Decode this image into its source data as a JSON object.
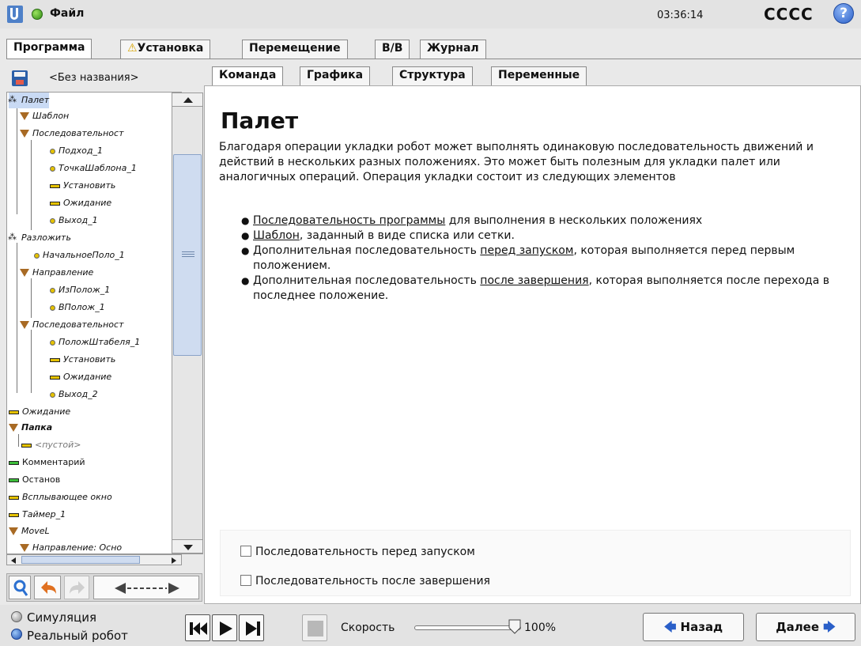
{
  "topbar": {
    "file_menu": "Файл",
    "clock": "03:36:14",
    "robot_name": "CCCC",
    "help_label": "?"
  },
  "main_tabs": [
    {
      "label": "Программа",
      "active": true
    },
    {
      "label": "Установка",
      "warning": true
    },
    {
      "label": "Перемещение"
    },
    {
      "label": "В/В"
    },
    {
      "label": "Журнал"
    }
  ],
  "left": {
    "program_name": "<Без названия>",
    "tree": [
      {
        "label": "Палет"
      },
      {
        "label": "Шаблон"
      },
      {
        "label": "Последовательност"
      },
      {
        "label": "Подход_1"
      },
      {
        "label": "ТочкаШаблона_1"
      },
      {
        "label": "Установить"
      },
      {
        "label": "Ожидание"
      },
      {
        "label": "Выход_1"
      },
      {
        "label": "Разложить"
      },
      {
        "label": "НачальноеПоло_1"
      },
      {
        "label": "Направление"
      },
      {
        "label": "ИзПолож_1"
      },
      {
        "label": "ВПолож_1"
      },
      {
        "label": "Последовательност"
      },
      {
        "label": "ПоложШтабеля_1"
      },
      {
        "label": "Установить"
      },
      {
        "label": "Ожидание"
      },
      {
        "label": "Выход_2"
      },
      {
        "label": "Ожидание"
      },
      {
        "label": "Папка"
      },
      {
        "label": "<пустой>"
      },
      {
        "label": "Комментарий"
      },
      {
        "label": "Останов"
      },
      {
        "label": "Всплывающее окно"
      },
      {
        "label": "Таймер_1"
      },
      {
        "label": "MoveL"
      },
      {
        "label": "Направление: Осно"
      }
    ]
  },
  "sub_tabs": [
    {
      "label": "Команда",
      "active": true
    },
    {
      "label": "Графика"
    },
    {
      "label": "Структура"
    },
    {
      "label": "Переменные"
    }
  ],
  "content": {
    "title": "Палет",
    "description": "Благодаря операции укладки робот может выполнять одинаковую последовательность движений и действий в нескольких разных положениях. Это может быть полезным для укладки палет или аналогичных операций. Операция укладки состоит из следующих элементов",
    "bullets": [
      {
        "link": "Последовательность программы",
        "rest": " для выполнения в нескольких положениях"
      },
      {
        "link": "Шаблон",
        "rest": ", заданный в виде списка или сетки."
      },
      {
        "pre": "Дополнительная последовательность ",
        "link": "перед запуском",
        "rest": ", которая выполняется перед первым положением."
      },
      {
        "pre": "Дополнительная последовательность ",
        "link": "после завершения",
        "rest": ", которая выполняется после перехода в последнее положение."
      }
    ],
    "checkbox_before": "Последовательность перед запуском",
    "checkbox_after": "Последовательность после завершения"
  },
  "bottom": {
    "simulation": "Симуляция",
    "real_robot": "Реальный робот",
    "speed_label": "Скорость",
    "speed_value": "100%",
    "speed_fraction": 1.0,
    "back": "Назад",
    "next": "Далее"
  },
  "colors": {
    "accent_blue": "#2a5fc8",
    "status_green": "#3cbd3a",
    "node_yellow": "#e5c200",
    "folder_brown": "#a86a24"
  }
}
